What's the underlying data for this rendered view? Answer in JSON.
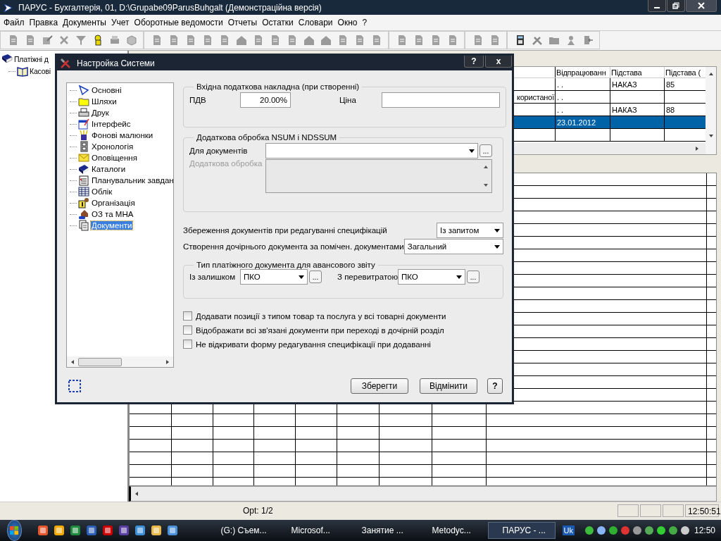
{
  "window": {
    "title": "ПАРУС - Бухгалтерія, 01, D:\\Grupabe09ParusBuhgalt (Демонстраційна версія)"
  },
  "menu": [
    "Файл",
    "Правка",
    "Документы",
    "Учет",
    "Оборотные ведомости",
    "Отчеты",
    "Остатки",
    "Словари",
    "Окно",
    "?"
  ],
  "tree": [
    {
      "label": "Платіжні д",
      "children": [
        {
          "label": "Касові"
        }
      ]
    }
  ],
  "table": {
    "headers": [
      "Відпрацюванн",
      "Підстава",
      "Підстава ("
    ],
    "rows": [
      {
        "selected": false,
        "column_2": ". .",
        "column_3": "НАКАЗ",
        "column_4": "85"
      },
      {
        "selected": false,
        "column_1": "користаної",
        "column_2": ". ."
      },
      {
        "selected": false,
        "column_2": ". .",
        "column_3": "НАКАЗ",
        "column_4": "88"
      },
      {
        "selected": true,
        "column_2": "23.01.2012"
      },
      {
        "selected": false
      }
    ]
  },
  "dialog": {
    "title": "Настройка Системи",
    "help_button": "?",
    "close_button": "x",
    "categories": [
      {
        "label": "Основні",
        "selected": false
      },
      {
        "label": "Шляхи",
        "selected": false
      },
      {
        "label": "Друк",
        "selected": false
      },
      {
        "label": "Інтерфейс",
        "selected": false
      },
      {
        "label": "Фонові малюнки",
        "selected": false
      },
      {
        "label": "Хронологія",
        "selected": false
      },
      {
        "label": "Оповіщення",
        "selected": false
      },
      {
        "label": "Каталоги",
        "selected": false
      },
      {
        "label": "Планувальник завдан",
        "selected": false
      },
      {
        "label": "Облік",
        "selected": false
      },
      {
        "label": "Організація",
        "selected": false
      },
      {
        "label": "ОЗ та МНА",
        "selected": false
      },
      {
        "label": "Документи",
        "selected": true
      }
    ],
    "vat_group": {
      "legend": "Вхідна податкова накладна (при створенні)",
      "vat_label": "ПДВ",
      "vat_value": "20.00%",
      "price_label": "Ціна"
    },
    "processing_group": {
      "legend": "Додаткова обробка NSUM і NDSSUM",
      "documents_label": "Для документів",
      "browse_button": "...",
      "extra_label": "Додаткова обробка",
      "extra_disabled": true
    },
    "options": [
      {
        "label": "Збереження документів при редагуванні специфікацій",
        "value": "Із запитом"
      },
      {
        "label": "Створення дочірнього документа за помічен. документами",
        "value": "Загальний"
      }
    ],
    "payment_group": {
      "legend": "Тип платіжного документа для авансового звіту",
      "fields": [
        {
          "label": "Із залишком",
          "value": "ПКО",
          "browse_button": "..."
        },
        {
          "label": "З перевитратою",
          "value": "ПКО",
          "browse_button": "..."
        }
      ]
    },
    "checkboxes": [
      {
        "label": "Додавати позиції з типом товар та послуга у всі товарні документи",
        "checked": false
      },
      {
        "label": "Відображати всі зв'язані документи при переході в дочірній розділ",
        "checked": false
      },
      {
        "label": "Не відкривати форму редагування специфікації при додаванні",
        "checked": false
      }
    ],
    "buttons": [
      "Зберегти",
      "Відмінити",
      "?"
    ]
  },
  "status_bar": {
    "text": "Opt: 1/2",
    "clock": "12:50:51"
  },
  "taskbar": {
    "tasks": [
      {
        "label": "(G:) Съем...",
        "selected": false
      },
      {
        "label": "Microsof...",
        "selected": false
      },
      {
        "label": "Занятие ...",
        "selected": false
      },
      {
        "label": "Metodyc...",
        "selected": false
      },
      {
        "label": "ПАРУС - ...",
        "selected": true
      }
    ],
    "language": "Uk",
    "clock": "12:50"
  }
}
